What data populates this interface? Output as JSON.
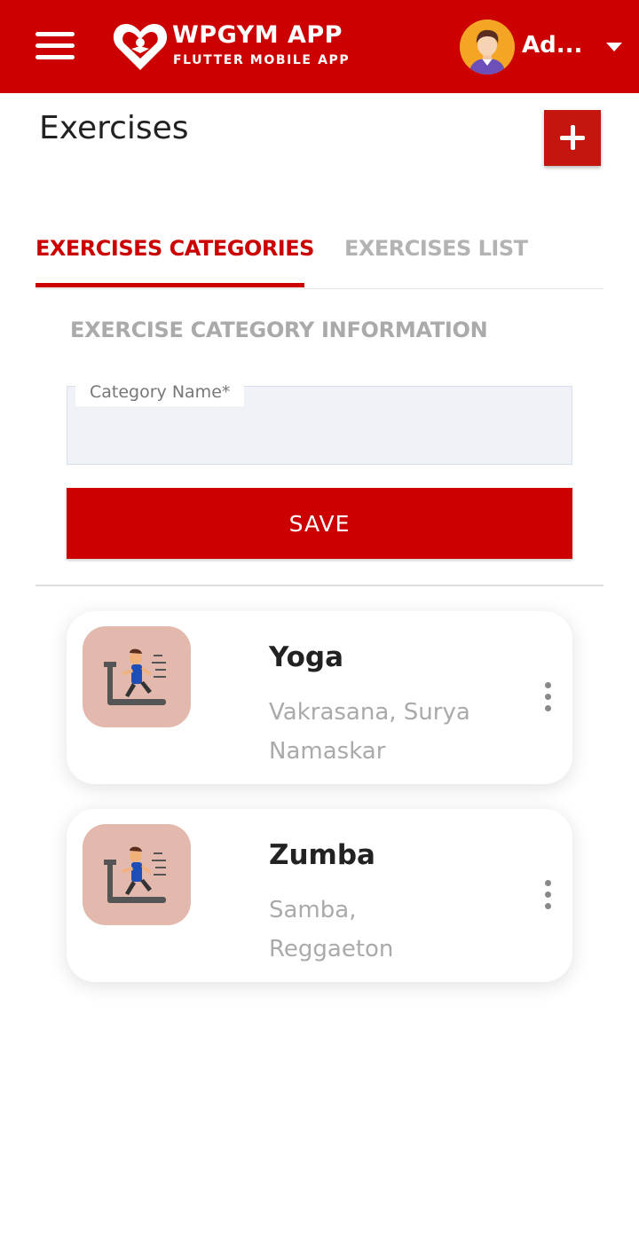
{
  "header": {
    "app_name": "WPGYM APP",
    "app_tagline": "FLUTTER MOBILE APP",
    "user_name": "Ad...",
    "brand_color": "#cc0000",
    "icons": {
      "menu": "hamburger-menu-icon",
      "logo": "heart-logo-icon",
      "avatar": "user-avatar-icon",
      "dropdown": "caret-down-icon"
    }
  },
  "page": {
    "title": "Exercises",
    "add_icon": "plus-icon"
  },
  "tabs": [
    {
      "label": "EXERCISES CATEGORIES",
      "active": true
    },
    {
      "label": "EXERCISES LIST",
      "active": false
    }
  ],
  "form": {
    "heading": "EXERCISE CATEGORY INFORMATION",
    "category_label": "Category Name*",
    "category_value": "",
    "save_label": "SAVE"
  },
  "categories": [
    {
      "name": "Yoga",
      "exercises": "Vakrasana, Surya Namaskar",
      "icon": "treadmill-runner-icon"
    },
    {
      "name": "Zumba",
      "exercises": "Samba, Reggaeton",
      "icon": "treadmill-runner-icon"
    }
  ]
}
